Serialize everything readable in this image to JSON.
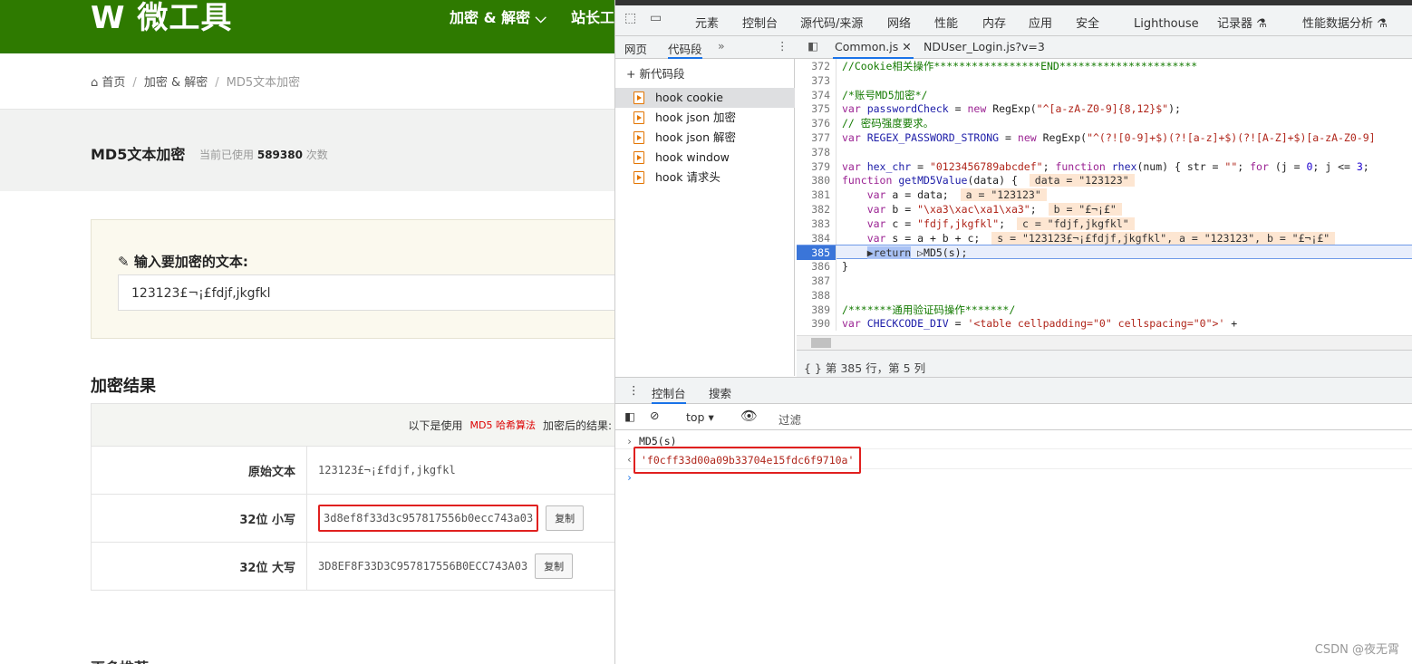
{
  "site": {
    "logo": "W 微工具",
    "nav": [
      "加密 & 解密 ⌵",
      "站长工"
    ],
    "breadcrumb": {
      "home": "首页",
      "section": "加密 & 解密",
      "current": "MD5文本加密"
    },
    "title": "MD5文本加密",
    "usage_prefix": "当前已使用",
    "usage_count": "589380",
    "usage_suffix": "次数",
    "input_label": "输入要加密的文本:",
    "input_value": "123123£¬¡£fdjf,jkgfkl",
    "result_title": "加密结果",
    "result_header": {
      "prefix": "以下是使用",
      "algo": "MD5 哈希算法",
      "suffix": "加密后的结果:"
    },
    "rows": [
      {
        "label": "原始文本",
        "value": "123123£¬¡£fdjf,jkgfkl"
      },
      {
        "label": "32位 小写",
        "value": "3d8ef8f33d3c957817556b0ecc743a03",
        "copy": "复制"
      },
      {
        "label": "32位 大写",
        "value": "3D8EF8F33D3C957817556B0ECC743A03",
        "copy": "复制"
      }
    ],
    "footer_partial": "更多推荐"
  },
  "devtools": {
    "tabs": [
      "元素",
      "控制台",
      "源代码/来源",
      "网络",
      "性能",
      "内存",
      "应用",
      "安全",
      "Lighthouse",
      "记录器 ⚗",
      "性能数据分析 ⚗"
    ],
    "active_tab": "源代码/来源",
    "sub_tabs": [
      "网页",
      "代码段",
      "»"
    ],
    "file_tabs": [
      "Common.js ✕",
      "NDUser_Login.js?v=3"
    ],
    "new_snippet": "+ 新代码段",
    "snippets": [
      "hook cookie",
      "hook json 加密",
      "hook json 解密",
      "hook window",
      "hook 请求头"
    ],
    "current_line": 385,
    "code": [
      {
        "n": 372,
        "t": [
          [
            "cm",
            "//Cookie相关操作*****************END**********************"
          ]
        ]
      },
      {
        "n": 373,
        "t": []
      },
      {
        "n": 374,
        "t": [
          [
            "cm",
            "/*账号MD5加密*/"
          ]
        ]
      },
      {
        "n": 375,
        "t": [
          [
            "kw",
            "var "
          ],
          [
            "id",
            "passwordCheck"
          ],
          [
            "pl",
            " = "
          ],
          [
            "kw",
            "new "
          ],
          [
            "pl",
            "RegExp("
          ],
          [
            "str",
            "\"^[a-zA-Z0-9]{8,12}$\""
          ],
          [
            "pl",
            ");"
          ]
        ]
      },
      {
        "n": 376,
        "t": [
          [
            "cm",
            "// 密码强度要求。"
          ]
        ]
      },
      {
        "n": 377,
        "t": [
          [
            "kw",
            "var "
          ],
          [
            "id",
            "REGEX_PASSWORD_STRONG"
          ],
          [
            "pl",
            " = "
          ],
          [
            "kw",
            "new "
          ],
          [
            "pl",
            "RegExp("
          ],
          [
            "str",
            "\"^(?![0-9]+$)(?![a-z]+$)(?![A-Z]+$)[a-zA-Z0-9]"
          ]
        ]
      },
      {
        "n": 378,
        "t": []
      },
      {
        "n": 379,
        "t": [
          [
            "kw",
            "var "
          ],
          [
            "id",
            "hex_chr"
          ],
          [
            "pl",
            " = "
          ],
          [
            "str",
            "\"0123456789abcdef\""
          ],
          [
            "pl",
            "; "
          ],
          [
            "kw",
            "function "
          ],
          [
            "id",
            "rhex"
          ],
          [
            "pl",
            "(num) { str = "
          ],
          [
            "str",
            "\"\""
          ],
          [
            "pl",
            "; "
          ],
          [
            "kw",
            "for "
          ],
          [
            "pl",
            "(j = "
          ],
          [
            "num",
            "0"
          ],
          [
            "pl",
            "; j <= "
          ],
          [
            "num",
            "3"
          ],
          [
            "pl",
            ";"
          ]
        ]
      },
      {
        "n": 380,
        "t": [
          [
            "kw",
            "function "
          ],
          [
            "id",
            "getMD5Value"
          ],
          [
            "pl",
            "(data) { "
          ]
        ],
        "ann": "data = \"123123\""
      },
      {
        "n": 381,
        "t": [
          [
            "pl",
            "    "
          ],
          [
            "kw",
            "var "
          ],
          [
            "pl",
            "a = data; "
          ]
        ],
        "ann": "a = \"123123\""
      },
      {
        "n": 382,
        "t": [
          [
            "pl",
            "    "
          ],
          [
            "kw",
            "var "
          ],
          [
            "pl",
            "b = "
          ],
          [
            "str",
            "\"\\xa3\\xac\\xa1\\xa3\""
          ],
          [
            "pl",
            "; "
          ]
        ],
        "ann": "b = \"£¬¡£\""
      },
      {
        "n": 383,
        "t": [
          [
            "pl",
            "    "
          ],
          [
            "kw",
            "var "
          ],
          [
            "pl",
            "c = "
          ],
          [
            "str",
            "\"fdjf,jkgfkl\""
          ],
          [
            "pl",
            "; "
          ]
        ],
        "ann": "c = \"fdjf,jkgfkl\""
      },
      {
        "n": 384,
        "t": [
          [
            "pl",
            "    "
          ],
          [
            "kw",
            "var "
          ],
          [
            "pl",
            "s = a + b + c; "
          ]
        ],
        "ann": "s = \"123123£¬¡£fdjf,jkgfkl\", a = \"123123\", b = \"£¬¡£\""
      },
      {
        "n": 385,
        "t": [
          [
            "pl",
            "    "
          ],
          [
            "hl",
            "▶return"
          ],
          [
            "pl",
            " ▷MD5(s);"
          ]
        ]
      },
      {
        "n": 386,
        "t": [
          [
            "pl",
            "}"
          ]
        ]
      },
      {
        "n": 387,
        "t": []
      },
      {
        "n": 388,
        "t": []
      },
      {
        "n": 389,
        "t": [
          [
            "cm",
            "/*******通用验证码操作*******/"
          ]
        ]
      },
      {
        "n": 390,
        "t": [
          [
            "kw",
            "var "
          ],
          [
            "id",
            "CHECKCODE_DIV"
          ],
          [
            "pl",
            " = "
          ],
          [
            "str",
            "'<table cellpadding=\"0\" cellspacing=\"0\">'"
          ],
          [
            "pl",
            " +"
          ]
        ]
      }
    ],
    "status": "第 385 行，第 5 列",
    "drawer_tabs": [
      "控制台",
      "搜索"
    ],
    "console_context": "top",
    "filter_placeholder": "过滤",
    "console_input": "MD5(s)",
    "console_output": "'f0cff33d00a09b33704e15fdc6f9710a'"
  },
  "watermark": "CSDN @夜无霄"
}
